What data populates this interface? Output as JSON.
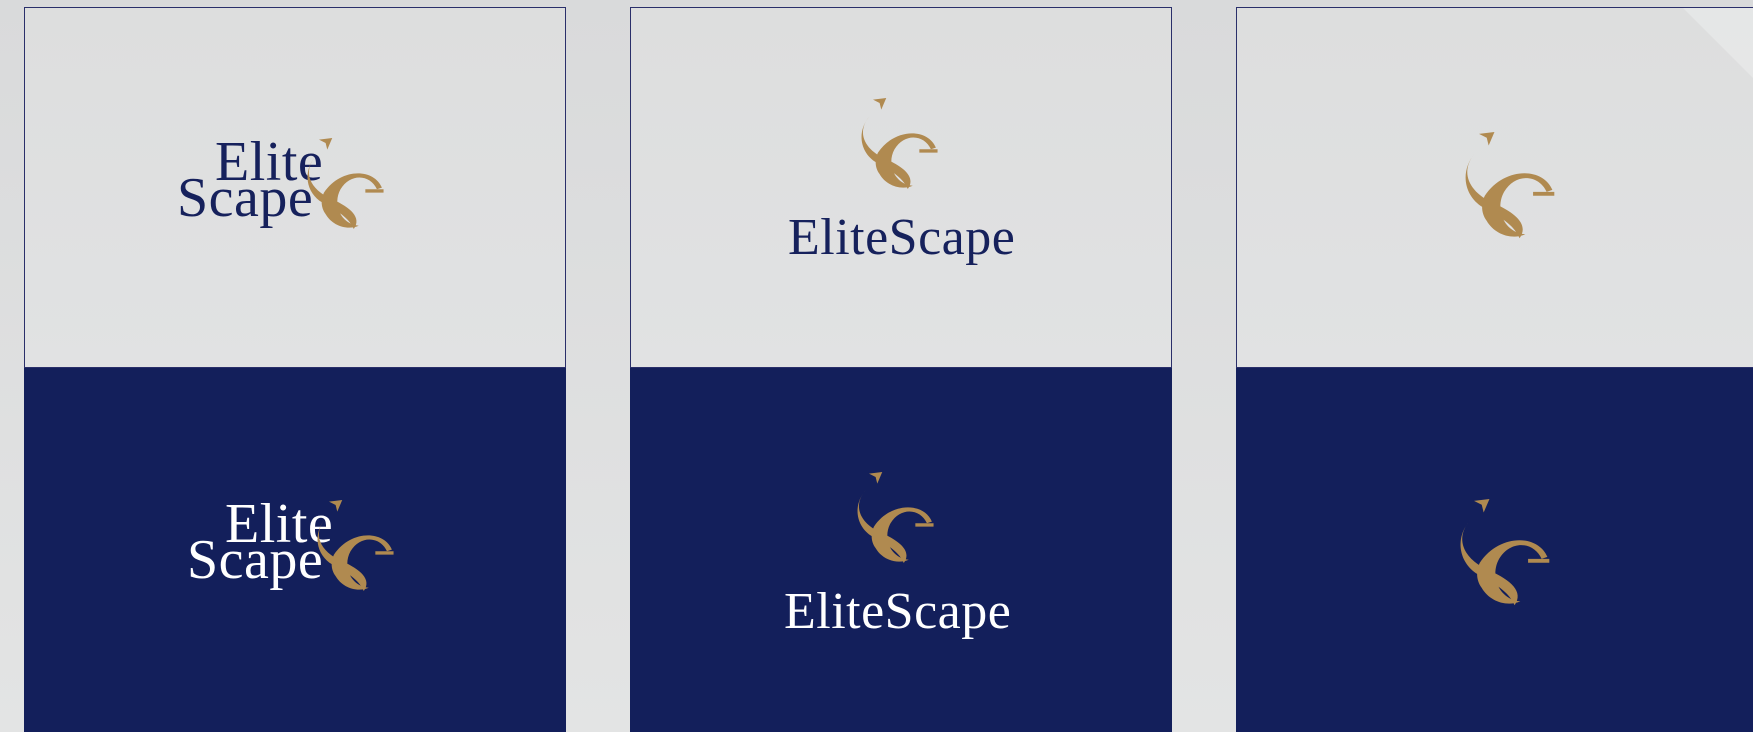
{
  "brand": {
    "word_first": "Elite",
    "word_second": "Scape",
    "word_full": "EliteScape"
  },
  "colors": {
    "navy": "#131f5b",
    "gold": "#b08a50",
    "light": "#dfe0e1",
    "white": "#ffffff"
  },
  "icons": {
    "monogram": "se-monogram-icon"
  }
}
